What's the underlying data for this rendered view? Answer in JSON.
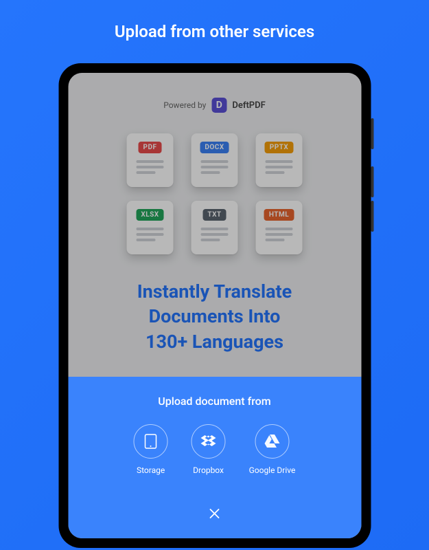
{
  "page": {
    "title": "Upload from other services"
  },
  "powered": {
    "prefix": "Powered by",
    "brand": "DeftPDF",
    "logo_letter": "D"
  },
  "file_types": [
    {
      "label": "PDF",
      "color": "#e94b4b"
    },
    {
      "label": "DOCX",
      "color": "#3b82f6"
    },
    {
      "label": "PPTX",
      "color": "#f59e0b"
    },
    {
      "label": "XLSX",
      "color": "#22a55a"
    },
    {
      "label": "TXT",
      "color": "#5b6470"
    },
    {
      "label": "HTML",
      "color": "#e8642f"
    }
  ],
  "hero": {
    "line1": "Instantly Translate",
    "line2": "Documents Into",
    "line3": "130+ Languages"
  },
  "sheet": {
    "title": "Upload document from",
    "options": [
      {
        "label": "Storage",
        "icon": "phone"
      },
      {
        "label": "Dropbox",
        "icon": "dropbox"
      },
      {
        "label": "Google Drive",
        "icon": "gdrive"
      }
    ]
  }
}
